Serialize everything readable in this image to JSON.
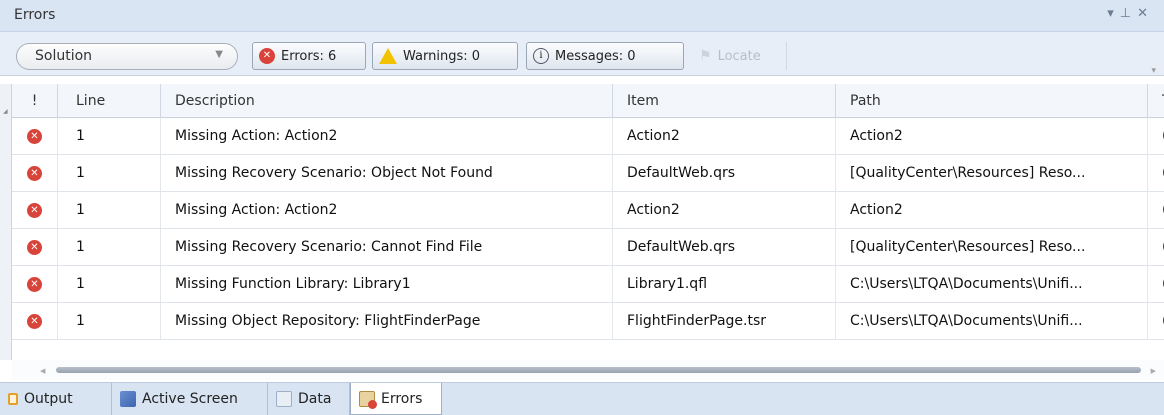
{
  "panel": {
    "title": "Errors",
    "controls": [
      "▾",
      "⊥",
      "✕"
    ]
  },
  "toolbar": {
    "scope_value": "Solution",
    "errors_label": "Errors: 6",
    "warnings_label": "Warnings: 0",
    "messages_label": "Messages: 0",
    "locate_label": "Locate"
  },
  "table": {
    "columns": [
      "!",
      "Line",
      "Description",
      "Item",
      "Path",
      "T"
    ],
    "rows": [
      {
        "line": "1",
        "description": "Missing Action: Action2",
        "item": "Action2",
        "path": "Action2",
        "t": "("
      },
      {
        "line": "1",
        "description": "Missing Recovery Scenario: Object Not Found",
        "item": "DefaultWeb.qrs",
        "path": "[QualityCenter\\Resources] Reso...",
        "t": "("
      },
      {
        "line": "1",
        "description": "Missing Action: Action2",
        "item": "Action2",
        "path": "Action2",
        "t": "("
      },
      {
        "line": "1",
        "description": "Missing Recovery Scenario: Cannot Find File",
        "item": "DefaultWeb.qrs",
        "path": "[QualityCenter\\Resources] Reso...",
        "t": "("
      },
      {
        "line": "1",
        "description": "Missing Function Library: Library1",
        "item": "Library1.qfl",
        "path": "C:\\Users\\LTQA\\Documents\\Unifi...",
        "t": "("
      },
      {
        "line": "1",
        "description": "Missing Object Repository: FlightFinderPage",
        "item": "FlightFinderPage.tsr",
        "path": "C:\\Users\\LTQA\\Documents\\Unifi...",
        "t": "("
      }
    ]
  },
  "tabs": [
    {
      "label": "Output",
      "icon": "output-icon"
    },
    {
      "label": "Active Screen",
      "icon": "active-screen-icon"
    },
    {
      "label": "Data",
      "icon": "data-icon"
    },
    {
      "label": "Errors",
      "icon": "errors-icon",
      "active": true
    }
  ]
}
